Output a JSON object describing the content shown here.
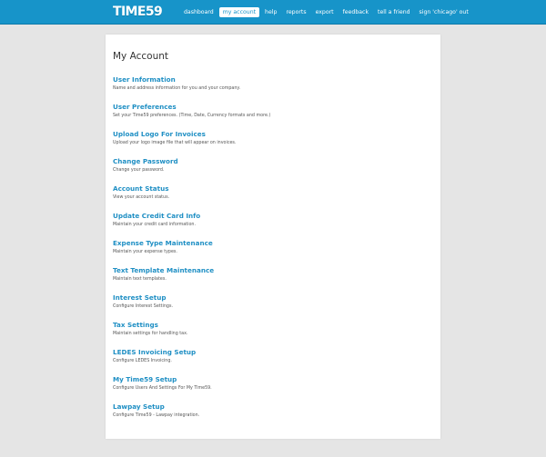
{
  "header": {
    "logo": "TIME59",
    "nav": [
      {
        "label": "dashboard",
        "active": false
      },
      {
        "label": "my account",
        "active": true
      },
      {
        "label": "help",
        "active": false
      },
      {
        "label": "reports",
        "active": false
      },
      {
        "label": "export",
        "active": false
      },
      {
        "label": "feedback",
        "active": false
      },
      {
        "label": "tell a friend",
        "active": false
      },
      {
        "label": "sign 'chicago' out",
        "active": false
      }
    ]
  },
  "main": {
    "title": "My Account",
    "items": [
      {
        "label": "User Information",
        "description": "Name and address information for you and your company."
      },
      {
        "label": "User Preferences",
        "description": "Set your Time59 preferences. (Time, Date, Currency formats and more.)"
      },
      {
        "label": "Upload Logo For Invoices",
        "description": "Upload your logo image file that will appear on invoices."
      },
      {
        "label": "Change Password",
        "description": "Change your password."
      },
      {
        "label": "Account Status",
        "description": "View your account status."
      },
      {
        "label": "Update Credit Card Info",
        "description": "Maintain your credit card information."
      },
      {
        "label": "Expense Type Maintenance",
        "description": "Maintain your expense types."
      },
      {
        "label": "Text Template Maintenance",
        "description": "Maintain text templates."
      },
      {
        "label": "Interest Setup",
        "description": "Configure Interest Settings."
      },
      {
        "label": "Tax Settings",
        "description": "Maintain settings for handling tax."
      },
      {
        "label": "LEDES Invoicing Setup",
        "description": "Configure LEDES Invoicing."
      },
      {
        "label": "My Time59 Setup",
        "description": "Configure Users And Settings For My Time59."
      },
      {
        "label": "Lawpay Setup",
        "description": "Configure Time59 - Lawpay integration."
      }
    ]
  },
  "colors": {
    "header_bg": "#1794c9",
    "link": "#1f8fc4",
    "page_bg": "#e5e5e5"
  }
}
